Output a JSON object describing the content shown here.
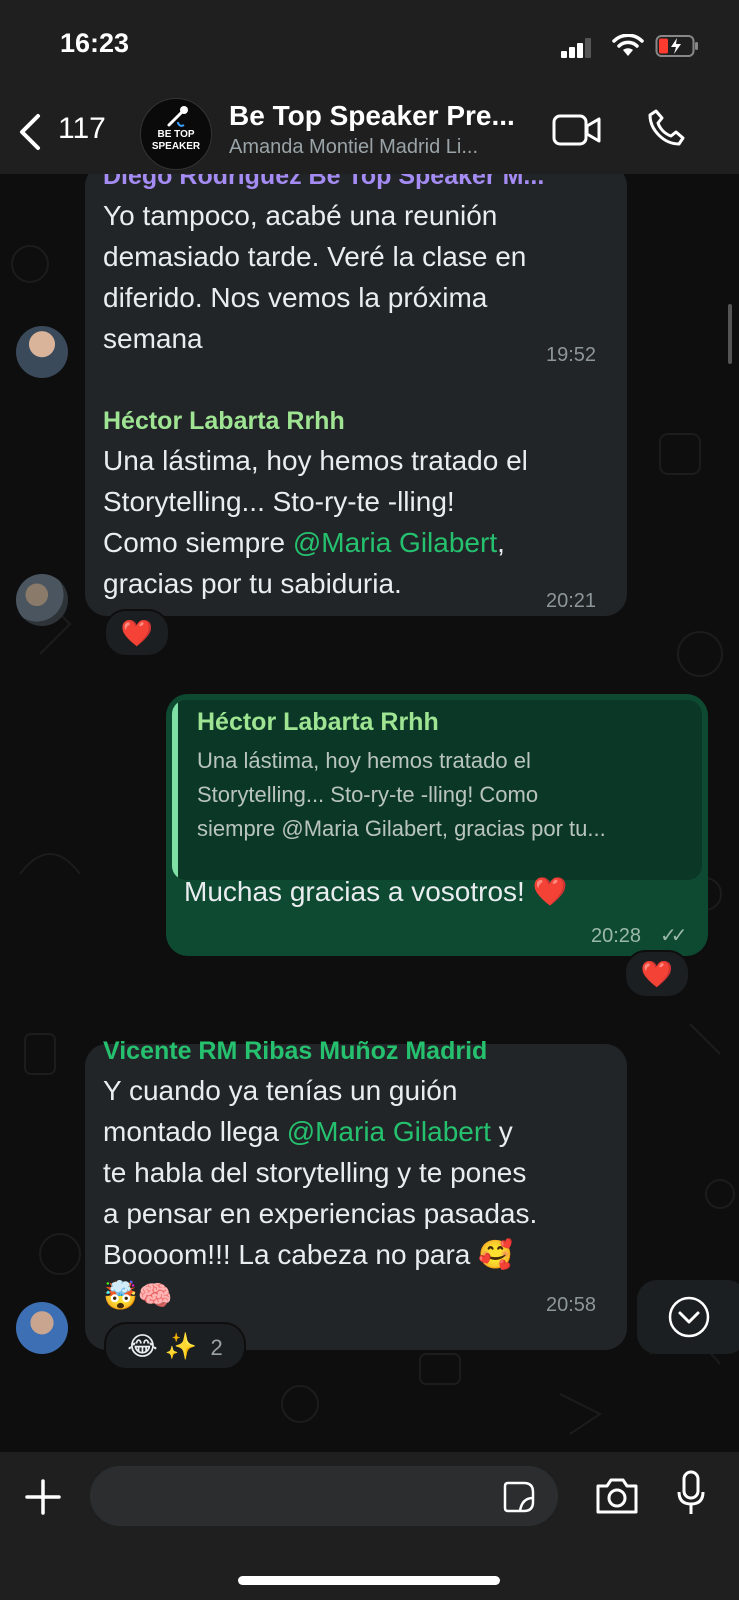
{
  "status_bar": {
    "time": "16:23"
  },
  "header": {
    "unread_count": "117",
    "group_avatar_text": "BE TOP SPEAKER",
    "group_title": "Be Top Speaker Pre...",
    "group_subtitle": "Amanda Montiel Madrid Li...",
    "icons": [
      "back-chevron-icon",
      "video-call-icon",
      "phone-call-icon"
    ]
  },
  "messages": [
    {
      "sender": "Diego Rodriguez Be Top Speaker M...",
      "sender_color": "#a58cf5",
      "lines": [
        "Yo tampoco, acabé una reunión",
        "demasiado tarde. Veré la clase en",
        "diferido. Nos vemos la próxima",
        "semana"
      ],
      "time": "19:52"
    },
    {
      "sender": "Héctor Labarta Rrhh",
      "sender_color": "#9ee493",
      "line1": "Una lástima, hoy hemos tratado el",
      "line2": "Storytelling... Sto-ry-te -lling!",
      "line3_pre": "Como siempre ",
      "line3_mention": "@Maria Gilabert",
      "line3_post": ",",
      "line4": "gracias por tu sabiduria.",
      "time": "20:21",
      "reaction": "❤️"
    },
    {
      "outgoing": true,
      "quote_sender": "Héctor Labarta Rrhh",
      "quote_lines": [
        "Una lástima, hoy hemos tratado el",
        "Storytelling... Sto-ry-te -lling! Como",
        "siempre @Maria Gilabert,  gracias por tu..."
      ],
      "text": "Muchas gracias a vosotros! ❤️",
      "time": "20:28",
      "read_receipt": "✓✓",
      "reaction": "❤️"
    },
    {
      "sender": "Vicente RM Ribas Muñoz Madrid",
      "sender_color": "#25c16f",
      "line1": "Y cuando ya tenías un guión",
      "line2_pre": "montado llega ",
      "line2_mention": "@Maria Gilabert",
      "line2_post": " y",
      "line3": "te habla del storytelling y te pones",
      "line4": "a pensar en experiencias pasadas.",
      "line5": "Boooom!!! La cabeza no para 🥰",
      "line6": "🤯🧠",
      "time": "20:58",
      "reaction_emojis": "😂 ✨",
      "reaction_count": "2"
    }
  ],
  "colors": {
    "incoming_bubble": "#222527",
    "outgoing_bubble": "#0e4a32",
    "mention": "#25c16f",
    "header_bg": "#1f1f1f"
  }
}
